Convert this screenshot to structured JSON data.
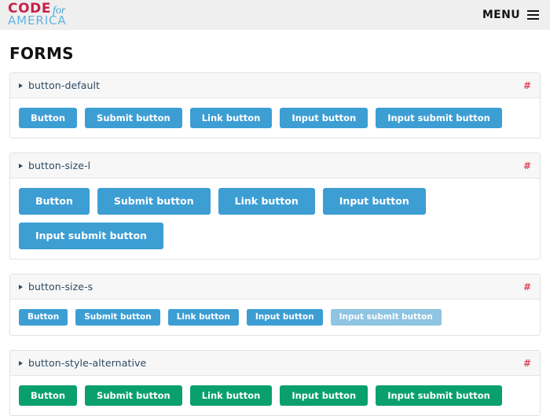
{
  "header": {
    "logo": {
      "code": "CODE",
      "for": "for",
      "america": "AMERICA"
    },
    "menu_label": "MENU",
    "menu_icon": "hamburger-icon"
  },
  "page": {
    "title": "FORMS"
  },
  "colors": {
    "topbar_bg": "#efefef",
    "logo_code": "#c8204a",
    "logo_for": "#3f9fd4",
    "logo_america": "#62b4e0",
    "panel_head_bg": "#f7f7f7",
    "panel_border": "#e2e2e2",
    "panel_name_text": "#2c4a63",
    "anchor_link": "#e0465e",
    "button_primary": "#3d9ed4",
    "button_primary_muted": "#8fc4e2",
    "button_alternative": "#0aa06e",
    "button_text": "#ffffff"
  },
  "sections": [
    {
      "name": "button-default",
      "anchor": "#",
      "size": "m",
      "style": "primary",
      "buttons": [
        {
          "label": "Button",
          "variant": "primary"
        },
        {
          "label": "Submit button",
          "variant": "primary"
        },
        {
          "label": "Link button",
          "variant": "primary"
        },
        {
          "label": "Input button",
          "variant": "primary"
        },
        {
          "label": "Input submit button",
          "variant": "primary"
        }
      ]
    },
    {
      "name": "button-size-l",
      "anchor": "#",
      "size": "l",
      "style": "primary",
      "buttons": [
        {
          "label": "Button",
          "variant": "primary"
        },
        {
          "label": "Submit button",
          "variant": "primary"
        },
        {
          "label": "Link button",
          "variant": "primary"
        },
        {
          "label": "Input button",
          "variant": "primary"
        },
        {
          "label": "Input submit button",
          "variant": "primary"
        }
      ]
    },
    {
      "name": "button-size-s",
      "anchor": "#",
      "size": "s",
      "style": "primary",
      "buttons": [
        {
          "label": "Button",
          "variant": "primary"
        },
        {
          "label": "Submit button",
          "variant": "primary"
        },
        {
          "label": "Link button",
          "variant": "primary"
        },
        {
          "label": "Input button",
          "variant": "primary"
        },
        {
          "label": "Input submit button",
          "variant": "muted"
        }
      ]
    },
    {
      "name": "button-style-alternative",
      "anchor": "#",
      "size": "m",
      "style": "alternative",
      "buttons": [
        {
          "label": "Button",
          "variant": "alt"
        },
        {
          "label": "Submit button",
          "variant": "alt"
        },
        {
          "label": "Link button",
          "variant": "alt"
        },
        {
          "label": "Input button",
          "variant": "alt"
        },
        {
          "label": "Input submit button",
          "variant": "alt"
        }
      ]
    }
  ]
}
